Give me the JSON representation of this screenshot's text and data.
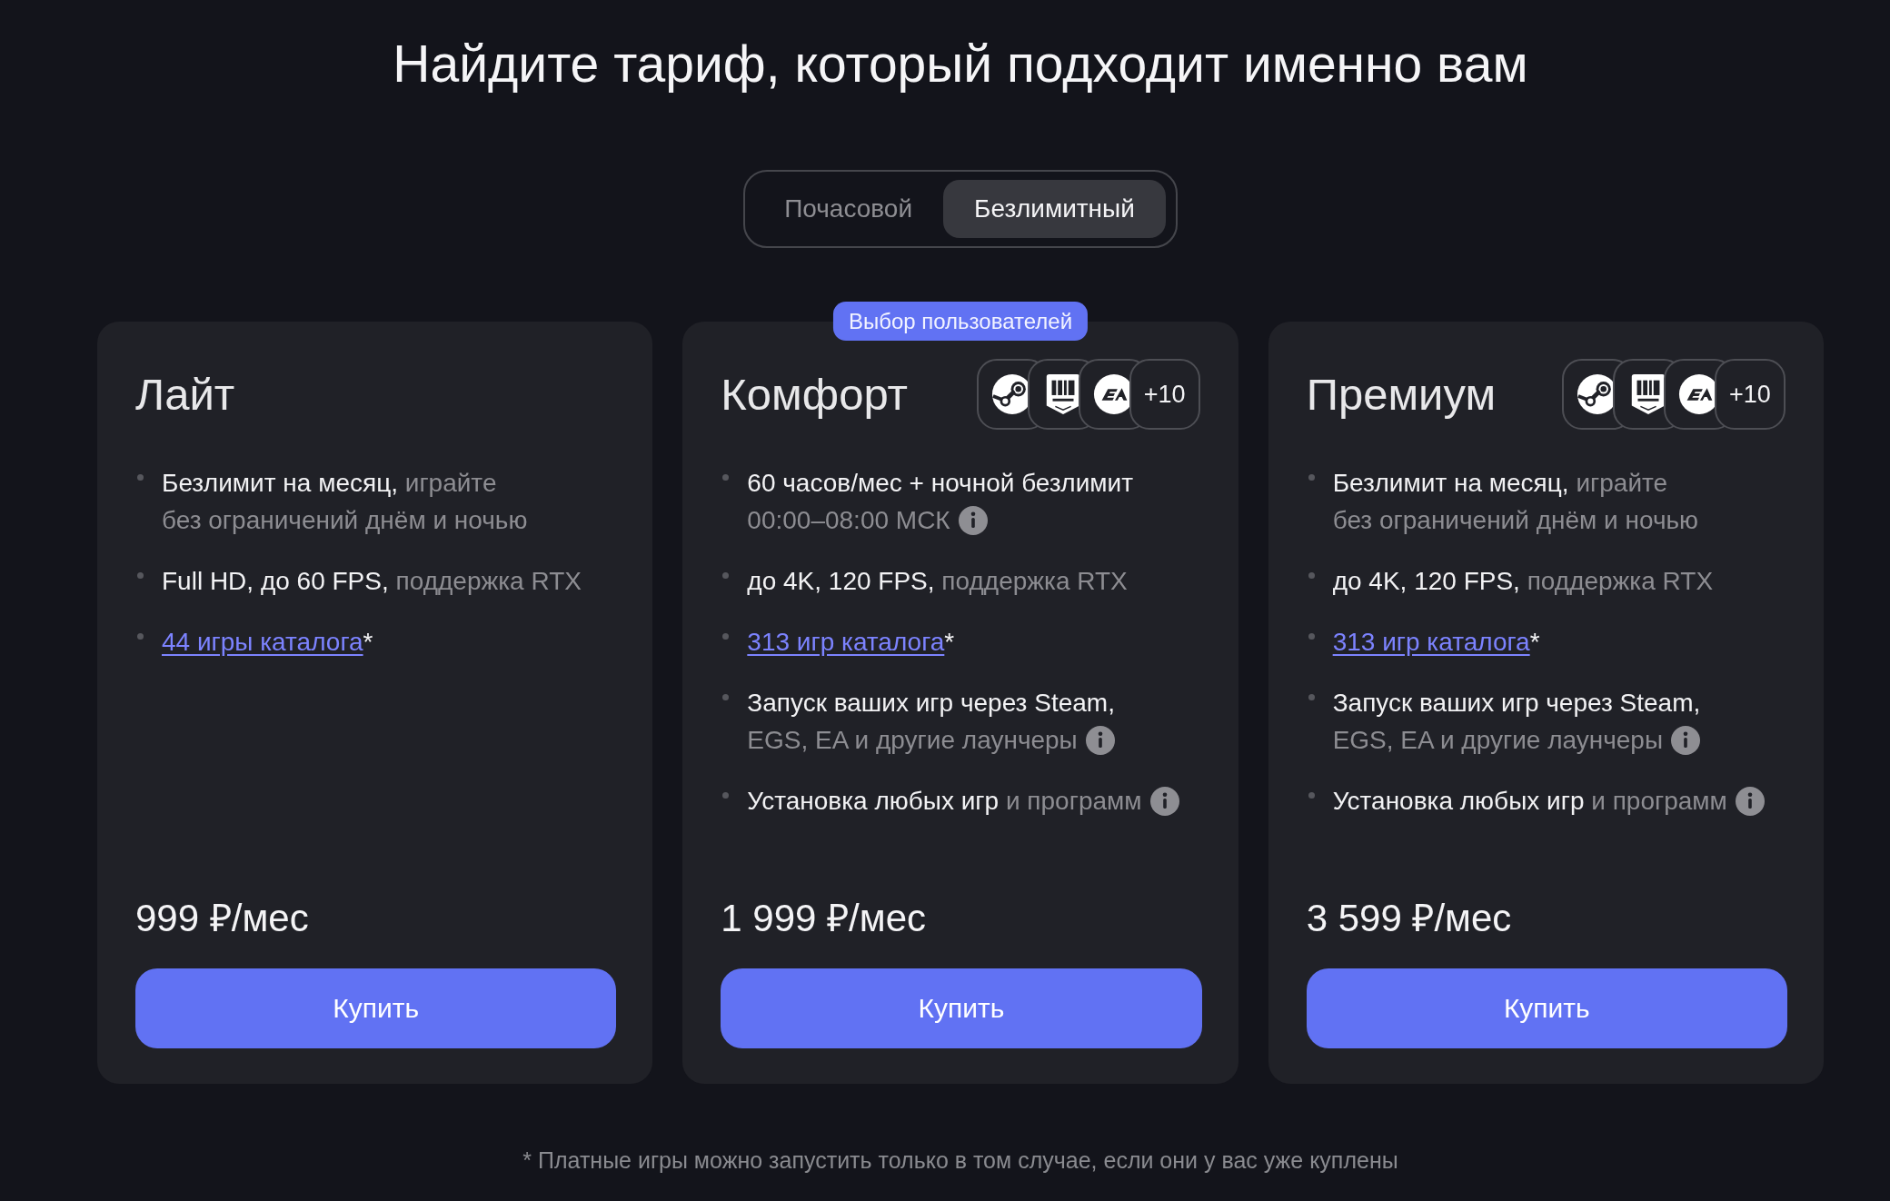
{
  "heading": "Найдите тариф, который подходит именно вам",
  "billing_toggle": {
    "options": [
      {
        "label": "Почасовой",
        "selected": false
      },
      {
        "label": "Безлимитный",
        "selected": true
      }
    ]
  },
  "plans": [
    {
      "name": "Лайт",
      "features": [
        {
          "kind": "text",
          "lines": [
            {
              "text": "Безлимит на месяц,",
              "note": "играйте"
            },
            {
              "note": "без ограничений днём и ночью"
            }
          ],
          "info": false
        },
        {
          "kind": "text",
          "lines": [
            {
              "text": "Full HD, до 60 FPS,",
              "note": "поддержка RTX"
            }
          ],
          "info": false
        },
        {
          "kind": "link",
          "link": "44 игры каталога",
          "suffix": "*"
        }
      ],
      "price": "999 ₽/мес",
      "button": "Купить"
    },
    {
      "name": "Комфорт",
      "badge": "Выбор пользователей",
      "launchers": {
        "more": "+10"
      },
      "features": [
        {
          "kind": "text",
          "lines": [
            {
              "text": "60 часов/мес + ночной безлимит"
            },
            {
              "note": "00:00–08:00 МСК"
            }
          ],
          "info": true
        },
        {
          "kind": "text",
          "lines": [
            {
              "text": "до 4K, 120 FPS,",
              "note": "поддержка RTX"
            }
          ],
          "info": false
        },
        {
          "kind": "link",
          "link": "313 игр каталога",
          "suffix": "*"
        },
        {
          "kind": "text",
          "lines": [
            {
              "text": "Запуск ваших игр через Steam,"
            },
            {
              "note": "EGS, EA и другие лаунчеры"
            }
          ],
          "info": true
        },
        {
          "kind": "text",
          "lines": [
            {
              "text": "Установка любых игр",
              "note": "и программ"
            }
          ],
          "info": true
        }
      ],
      "price": "1 999 ₽/мес",
      "button": "Купить"
    },
    {
      "name": "Премиум",
      "launchers": {
        "more": "+10"
      },
      "features": [
        {
          "kind": "text",
          "lines": [
            {
              "text": "Безлимит на месяц,",
              "note": "играйте"
            },
            {
              "note": "без ограничений днём и ночью"
            }
          ],
          "info": false
        },
        {
          "kind": "text",
          "lines": [
            {
              "text": "до 4K, 120 FPS,",
              "note": "поддержка RTX"
            }
          ],
          "info": false
        },
        {
          "kind": "link",
          "link": "313 игр каталога",
          "suffix": "*"
        },
        {
          "kind": "text",
          "lines": [
            {
              "text": "Запуск ваших игр через Steam,"
            },
            {
              "note": "EGS, EA и другие лаунчеры"
            }
          ],
          "info": true
        },
        {
          "kind": "text",
          "lines": [
            {
              "text": "Установка любых игр",
              "note": "и программ"
            }
          ],
          "info": true
        }
      ],
      "price": "3 599 ₽/мес",
      "button": "Купить"
    }
  ],
  "footnote": "* Платные игры можно запустить только в том случае, если они у вас уже куплены"
}
